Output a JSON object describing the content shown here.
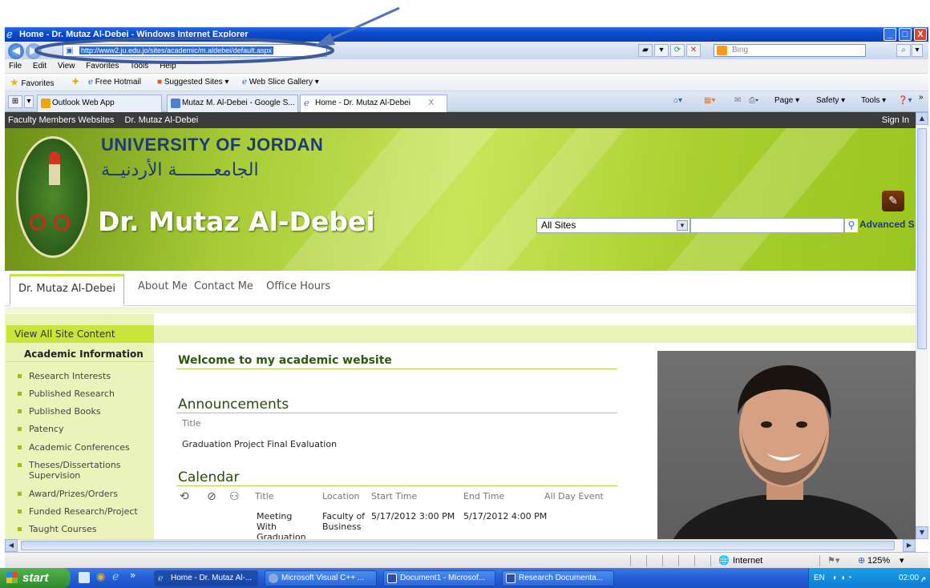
{
  "window": {
    "title": "Home - Dr. Mutaz Al-Debei - Windows Internet Explorer",
    "minimize": "_",
    "maximize": "□",
    "close": "X"
  },
  "address_bar": {
    "url": "http://www2.ju.edu.jo/sites/academic/m.aldebei/default.aspx",
    "search_placeholder": "Bing"
  },
  "menu": [
    "File",
    "Edit",
    "View",
    "Favorites",
    "Tools",
    "Help"
  ],
  "favorites_bar": {
    "favorites_label": "Favorites",
    "items": [
      "Free Hotmail",
      "Suggested Sites ▾",
      "Web Slice Gallery ▾"
    ]
  },
  "tabs": [
    {
      "label": "Outlook Web App",
      "active": false
    },
    {
      "label": "Mutaz M. Al-Debei - Google S...",
      "active": false
    },
    {
      "label": "Home - Dr. Mutaz Al-Debei",
      "active": true
    }
  ],
  "tab_close": "X",
  "command_bar": [
    "Page ▾",
    "Safety ▾",
    "Tools ▾"
  ],
  "site": {
    "top_nav": [
      "Faculty Members Websites",
      "Dr. Mutaz Al-Debei"
    ],
    "sign_in": "Sign In",
    "university_name": "UNIVERSITY OF JORDAN",
    "university_arabic": "الجامعـــــــة الأردنيــة",
    "site_title": "Dr. Mutaz Al-Debei",
    "search_scope": "All Sites",
    "advanced_search": "Advanced S",
    "top_links": [
      "Dr. Mutaz Al-Debei",
      "About Me",
      "Contact Me",
      "Office Hours"
    ],
    "view_all": "View All Site Content",
    "quick_launch_heading": "Academic Information",
    "quick_launch": [
      "Research Interests",
      "Published Research",
      "Published Books",
      "Patency",
      "Academic Conferences",
      "Theses/Dissertations Supervision",
      "Award/Prizes/Orders",
      "Funded Research/Project",
      "Taught Courses"
    ],
    "welcome": "Welcome to my academic website",
    "announcements": {
      "heading": "Announcements",
      "column": "Title",
      "items": [
        "Graduation Project Final Evaluation"
      ]
    },
    "calendar": {
      "heading": "Calendar",
      "columns": [
        "Title",
        "Location",
        "Start Time",
        "End Time",
        "All Day Event"
      ],
      "rows": [
        {
          "title": "Meeting With Graduation",
          "location": "Faculty of Business",
          "start": "5/17/2012 3:00 PM",
          "end": "5/17/2012 4:00 PM"
        }
      ]
    }
  },
  "status_bar": {
    "zone": "Internet",
    "zoom": "125%"
  },
  "taskbar": {
    "start": "start",
    "items": [
      {
        "label": "Home - Dr. Mutaz Al-...",
        "active": true
      },
      {
        "label": "Microsoft Visual C++ ...",
        "active": false
      },
      {
        "label": "Document1 - Microsof...",
        "active": false
      },
      {
        "label": "Research Documenta...",
        "active": false
      }
    ],
    "lang": "EN",
    "clock": "02:00 م"
  },
  "colors": {
    "title_bar": "#0a4bd1",
    "banner_green": "#a7cc35",
    "annotation": "#3c5a99"
  }
}
